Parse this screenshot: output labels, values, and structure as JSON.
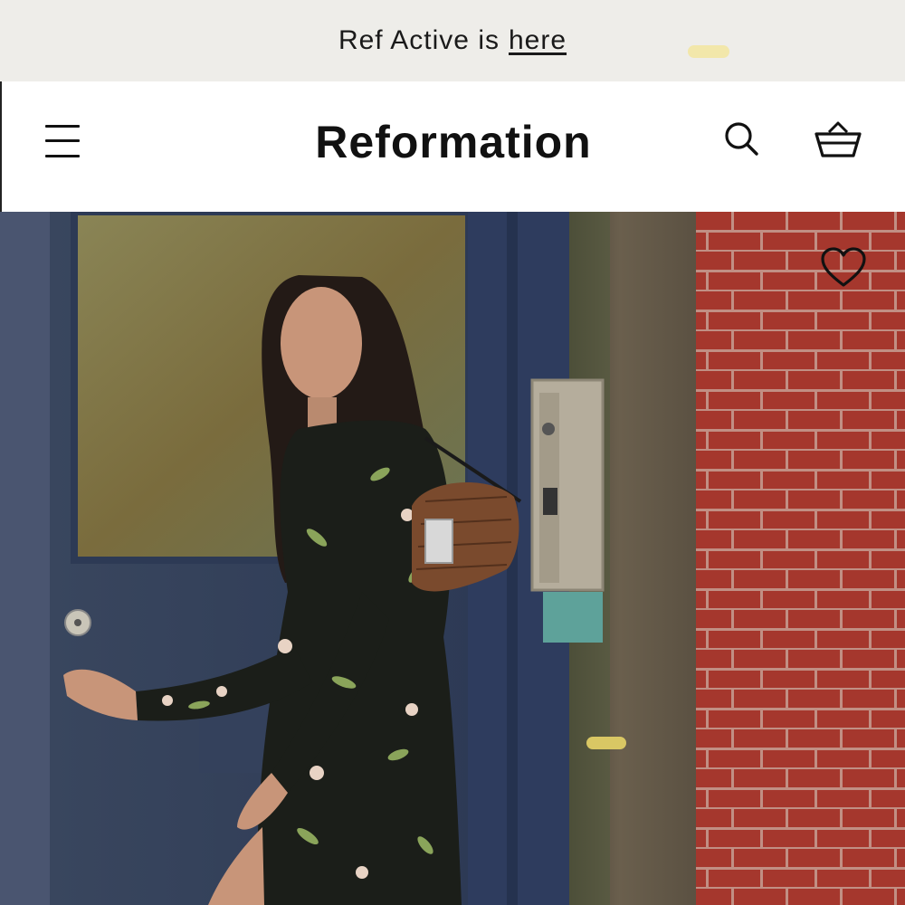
{
  "promo": {
    "text": "Ref Active is",
    "link_label": "here"
  },
  "header": {
    "logo": "Reformation",
    "icons": [
      "menu-icon",
      "search-icon",
      "basket-icon"
    ]
  },
  "hero": {
    "image_description": "model in black floral dress holding door handle",
    "icons": [
      "heart-icon"
    ]
  },
  "colors": {
    "promo_bg": "#eeede9",
    "text": "#111111",
    "brick": "#a63a30",
    "door": "#3b4a66"
  }
}
